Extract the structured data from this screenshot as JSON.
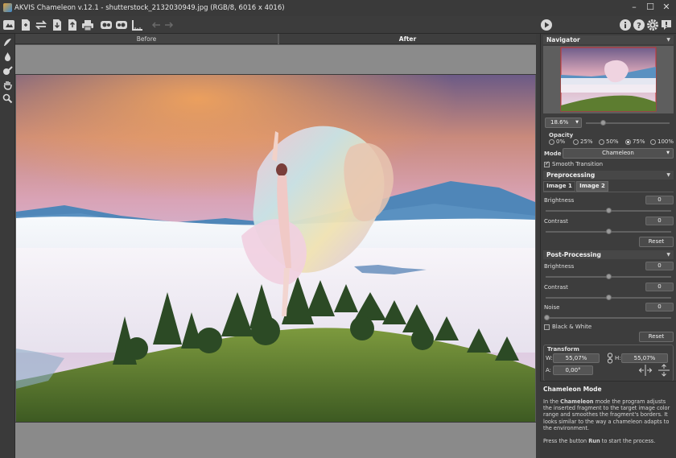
{
  "window": {
    "title": "AKVIS Chameleon v.12.1 - shutterstock_2132030949.jpg (RGB/8, 6016 x 4016)"
  },
  "canvas": {
    "tab_before": "Before",
    "tab_after": "After"
  },
  "navigator": {
    "title": "Navigator",
    "zoom": "18.6%"
  },
  "opacity": {
    "label": "Opacity",
    "options": [
      "0%",
      "25%",
      "50%",
      "75%",
      "100%"
    ],
    "selected": "75%"
  },
  "mode": {
    "label": "Mode",
    "value": "Chameleon",
    "smooth_transition": "Smooth Transition"
  },
  "preprocessing": {
    "title": "Preprocessing",
    "tabs": [
      "Image 1",
      "Image 2"
    ],
    "brightness_label": "Brightness",
    "brightness": "0",
    "contrast_label": "Contrast",
    "contrast": "0",
    "reset": "Reset"
  },
  "postprocessing": {
    "title": "Post-Processing",
    "brightness_label": "Brightness",
    "brightness": "0",
    "contrast_label": "Contrast",
    "contrast": "0",
    "noise_label": "Noise",
    "noise": "0",
    "bw_label": "Black & White",
    "reset": "Reset"
  },
  "transform": {
    "title": "Transform",
    "w_label": "W:",
    "w": "55,07%",
    "h_label": "H:",
    "h": "55,07%",
    "a_label": "A:",
    "a": "0,00°"
  },
  "info": {
    "title": "Chameleon Mode",
    "p1_a": "In the ",
    "p1_b": "Chameleon",
    "p1_c": " mode the program adjusts the inserted fragment to the target image color range and smoothes the fragment's borders. It looks similar to the way a chameleon adapts to the environment.",
    "p2_a": "Press the button ",
    "p2_b": "Run",
    "p2_c": " to start the process."
  },
  "icons": {
    "app": "app-icon",
    "minimize": "minimize-icon",
    "maximize": "maximize-icon",
    "close": "close-icon",
    "run": "run-icon",
    "info": "info-icon",
    "help": "help-icon",
    "settings": "gear-icon",
    "notify": "notification-icon"
  }
}
